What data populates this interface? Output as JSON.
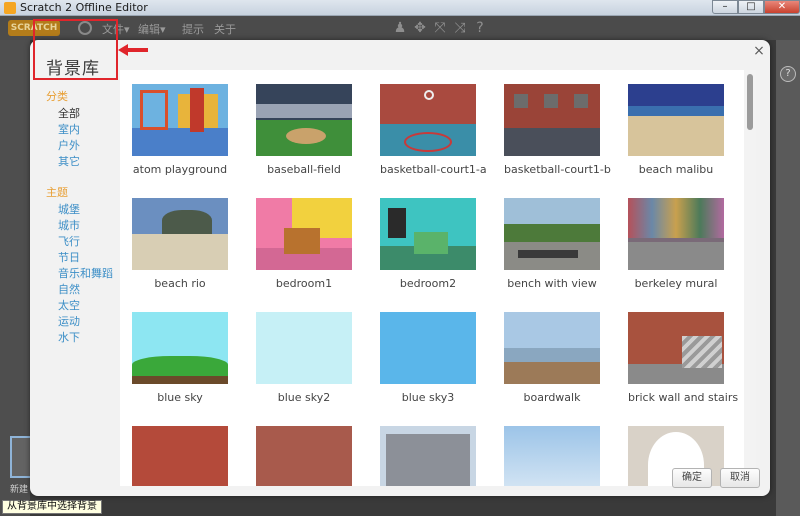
{
  "window": {
    "title": "Scratch 2 Offline Editor",
    "min": "–",
    "max": "□",
    "close": "✕"
  },
  "menubar": {
    "logo": "SCRATCH",
    "items": [
      {
        "label": "文件▾"
      },
      {
        "label": "编辑▾"
      },
      {
        "label": "提示"
      },
      {
        "label": "关于"
      }
    ],
    "tools": [
      {
        "icon": "duplicate-stamp-icon",
        "glyph": "♟"
      },
      {
        "icon": "cut-scissors-icon",
        "glyph": "✥"
      },
      {
        "icon": "grow-icon",
        "glyph": "⤧"
      },
      {
        "icon": "shrink-icon",
        "glyph": "⤨"
      },
      {
        "icon": "help-icon",
        "glyph": "?"
      }
    ]
  },
  "dialog": {
    "title": "背景库",
    "close_glyph": "×",
    "category_header": "分类",
    "categories": [
      {
        "label": "全部",
        "active": true
      },
      {
        "label": "室内"
      },
      {
        "label": "户外"
      },
      {
        "label": "其它"
      }
    ],
    "theme_header": "主题",
    "themes": [
      {
        "label": "城堡"
      },
      {
        "label": "城市"
      },
      {
        "label": "飞行"
      },
      {
        "label": "节日"
      },
      {
        "label": "音乐和舞蹈"
      },
      {
        "label": "自然"
      },
      {
        "label": "太空"
      },
      {
        "label": "运动"
      },
      {
        "label": "水下"
      }
    ],
    "backdrops": [
      {
        "label": "atom playground"
      },
      {
        "label": "baseball-field"
      },
      {
        "label": "basketball-court1-a"
      },
      {
        "label": "basketball-court1-b"
      },
      {
        "label": "beach malibu"
      },
      {
        "label": "beach rio"
      },
      {
        "label": "bedroom1"
      },
      {
        "label": "bedroom2"
      },
      {
        "label": "bench with view"
      },
      {
        "label": "berkeley mural"
      },
      {
        "label": "blue sky"
      },
      {
        "label": "blue sky2"
      },
      {
        "label": "blue sky3"
      },
      {
        "label": "boardwalk"
      },
      {
        "label": "brick wall and stairs"
      },
      {
        "label": ""
      },
      {
        "label": ""
      },
      {
        "label": ""
      },
      {
        "label": ""
      },
      {
        "label": ""
      }
    ],
    "ok_label": "确定",
    "cancel_label": "取消"
  },
  "left_panel": {
    "new_backdrop_label": "新建"
  },
  "tooltip": "从背景库中选择背景",
  "colors": {
    "highlight": "#e0252b",
    "category_header": "#e89f34",
    "link": "#3d8fc7"
  }
}
